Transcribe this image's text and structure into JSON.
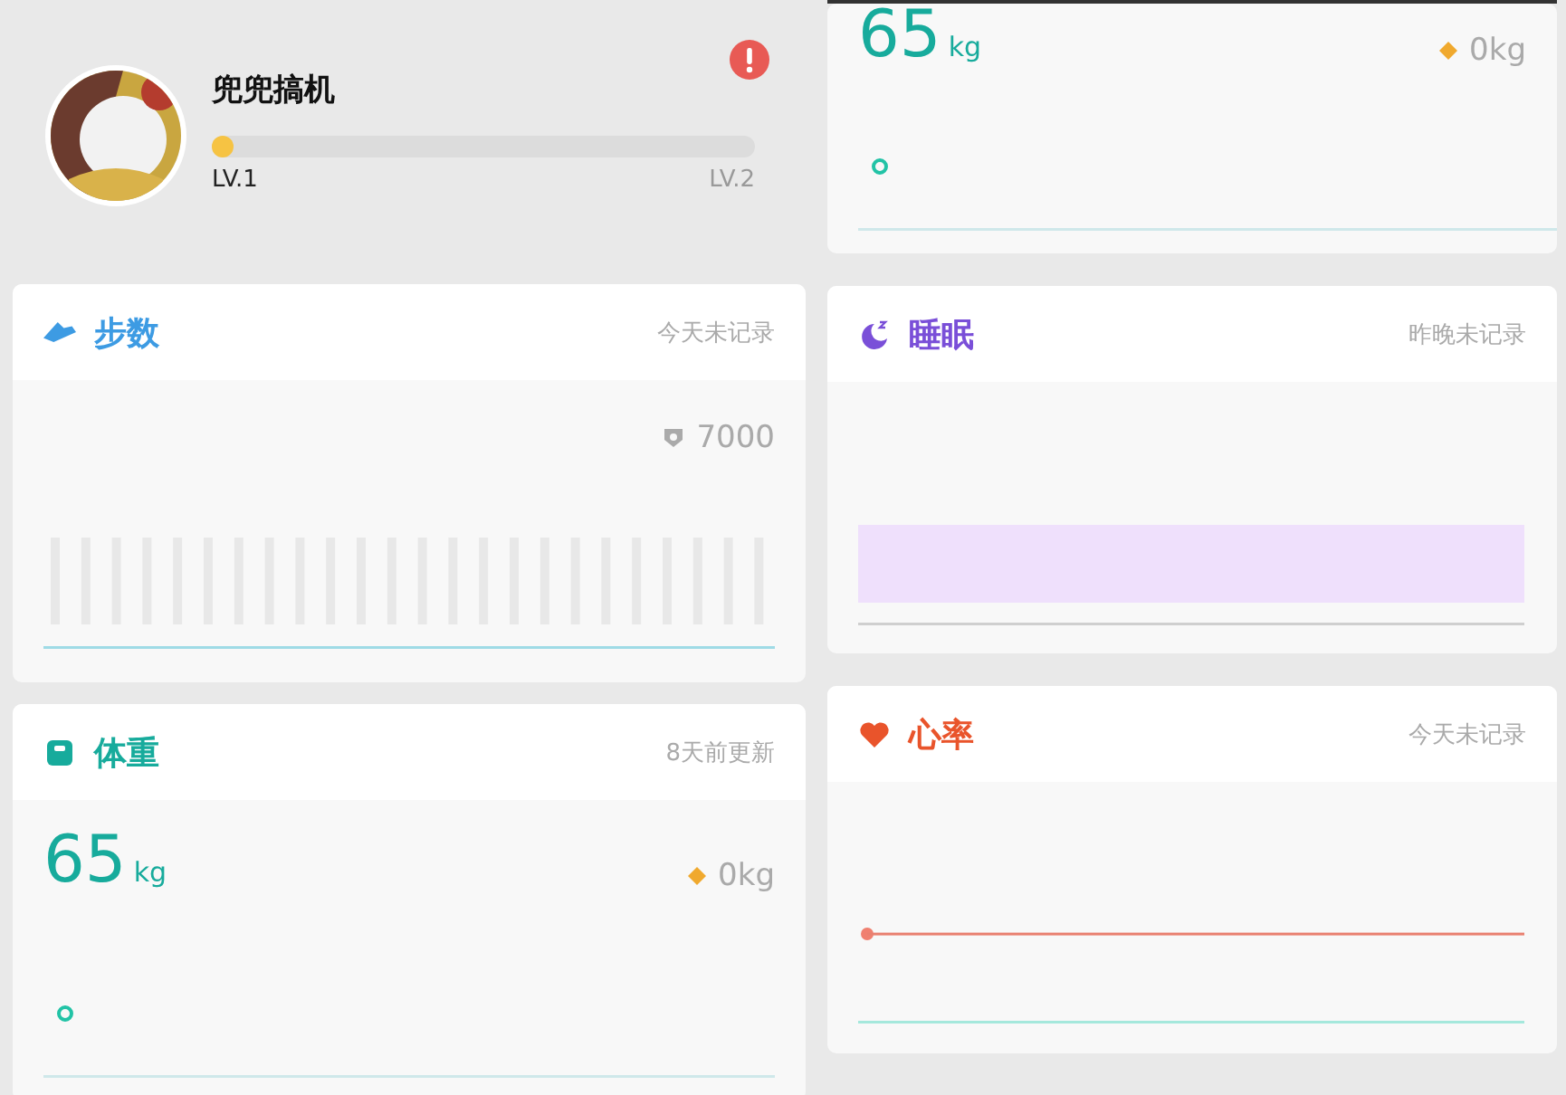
{
  "profile": {
    "name": "兜兜搞机",
    "progress": {
      "level": 0.02
    },
    "level_start": "LV.1",
    "level_end": "LV.2"
  },
  "columns": [
    {
      "cards": [
        {
          "kind": "steps",
          "title": "步数",
          "status": "今天未记录",
          "goal": "7000"
        },
        {
          "kind": "weight",
          "title": "体重",
          "status": "8天前更新",
          "value": "65",
          "unit": "kg",
          "change": "0kg"
        }
      ]
    },
    {
      "cards": [
        {
          "kind": "weight",
          "value": "65",
          "unit": "kg",
          "change": "0kg"
        },
        {
          "kind": "sleep",
          "title": "睡眠",
          "status": "昨晚未记录"
        },
        {
          "kind": "heart",
          "title": "心率",
          "status": "今天未记录"
        }
      ]
    }
  ]
}
